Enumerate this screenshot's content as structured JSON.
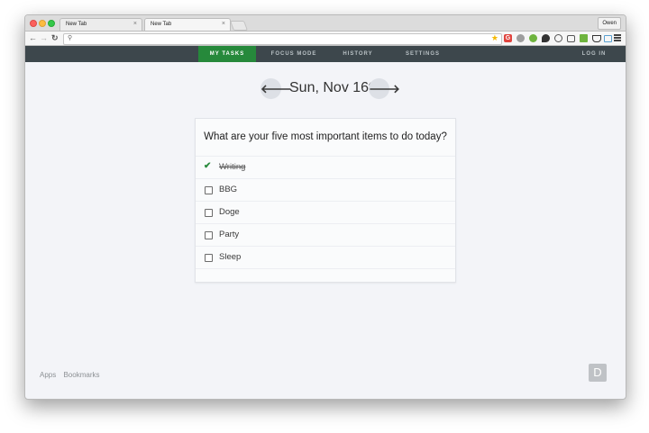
{
  "browser": {
    "tabs": [
      {
        "label": "New Tab",
        "close": "×"
      },
      {
        "label": "New Tab",
        "close": "×"
      }
    ],
    "profile_name": "Owen",
    "extension_g_label": "G"
  },
  "app_nav": {
    "items": [
      {
        "label": "MY TASKS"
      },
      {
        "label": "FOCUS MODE"
      },
      {
        "label": "HISTORY"
      },
      {
        "label": "SETTINGS"
      }
    ],
    "login_label": "LOG IN"
  },
  "date_header": {
    "prev_glyph": "🡐",
    "next_glyph": "🡒",
    "date": "Sun, Nov 16th"
  },
  "tasks_card": {
    "question": "What are your five most important items to do today?",
    "tasks": [
      {
        "label": "Writing",
        "done": true
      },
      {
        "label": "BBG",
        "done": false
      },
      {
        "label": "Doge",
        "done": false
      },
      {
        "label": "Party",
        "done": false
      },
      {
        "label": "Sleep",
        "done": false
      }
    ]
  },
  "footer": {
    "links": [
      {
        "label": "Apps"
      },
      {
        "label": "Bookmarks"
      }
    ],
    "badge": "D"
  },
  "colors": {
    "nav_bg": "#3d474c",
    "nav_active": "#26893b",
    "check_green": "#2a8b3e",
    "page_bg": "#f3f4f8"
  }
}
